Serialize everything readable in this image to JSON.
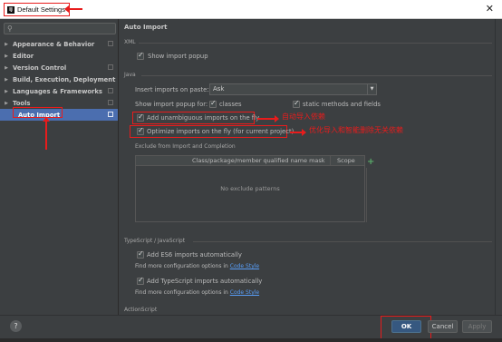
{
  "window": {
    "title": "Default Settings",
    "close": "✕"
  },
  "sidebar": {
    "search_placeholder": "",
    "search_icon": "search-icon",
    "items": [
      {
        "label": "Appearance & Behavior",
        "expanded": false
      },
      {
        "label": "Editor",
        "expanded": false
      },
      {
        "label": "Version Control",
        "expanded": false
      },
      {
        "label": "Build, Execution, Deployment",
        "expanded": false
      },
      {
        "label": "Languages & Frameworks",
        "expanded": false
      },
      {
        "label": "Tools",
        "expanded": false
      },
      {
        "label": "Auto Import",
        "selected": true
      }
    ]
  },
  "main": {
    "header": "Auto Import",
    "xml": {
      "section": "XML",
      "show_import_popup": {
        "label": "Show import popup",
        "checked": true
      }
    },
    "java": {
      "section": "Java",
      "insert_label": "Insert imports on paste:",
      "insert_value": "Ask",
      "popup_for_label": "Show import popup for:",
      "classes": {
        "label": "classes",
        "checked": true
      },
      "static": {
        "label": "static methods and fields",
        "checked": true
      },
      "unambiguous": {
        "label": "Add unambiguous imports on the fly",
        "checked": true
      },
      "optimize": {
        "label": "Optimize imports on the fly (for current project)",
        "checked": true
      },
      "exclude_label": "Exclude from Import and Completion",
      "table": {
        "col1": "Class/package/member qualified name mask",
        "col2": "Scope",
        "empty": "No exclude patterns",
        "add": "+"
      }
    },
    "ts": {
      "section": "TypeScript / JavaScript",
      "es6": {
        "label": "Add ES6 imports automatically",
        "checked": true
      },
      "find_more_1": "Find more configuration options in",
      "code_style_1": "Code Style",
      "tsimports": {
        "label": "Add TypeScript imports automatically",
        "checked": true
      },
      "find_more_2": "Find more configuration options in",
      "code_style_2": "Code Style",
      "next_section": "ActionScript"
    },
    "notes": {
      "unambiguous": "自动导入依赖",
      "optimize": "优化导入和智能删除无关依赖"
    }
  },
  "footer": {
    "help": "?",
    "ok": "OK",
    "cancel": "Cancel",
    "apply": "Apply"
  },
  "colors": {
    "background": "#3c3f41",
    "selection": "#4b6eaf",
    "annotation": "#e81c1c",
    "link": "#589df6",
    "ok_button": "#365880"
  }
}
